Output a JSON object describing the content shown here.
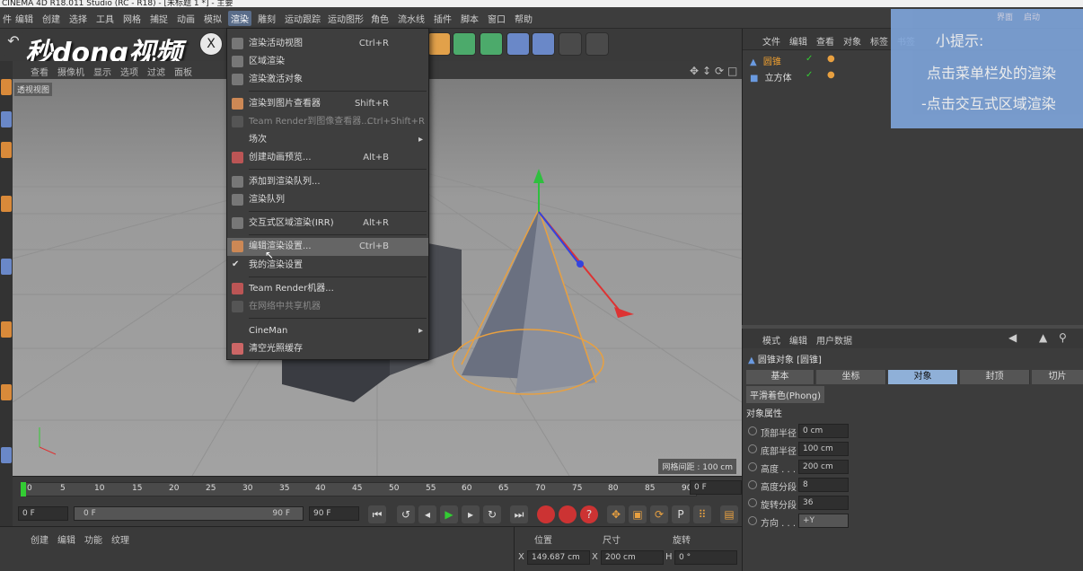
{
  "window": {
    "title": "CINEMA 4D R18.011 Studio (RC - R18) - [未标题 1 *] - 主要"
  },
  "menubar": [
    "件",
    "编辑",
    "创建",
    "选择",
    "工具",
    "网格",
    "捕捉",
    "动画",
    "模拟",
    "渲染",
    "雕刻",
    "运动跟踪",
    "运动图形",
    "角色",
    "流水线",
    "插件",
    "脚本",
    "窗口",
    "帮助"
  ],
  "logo": "秒dong视频",
  "viewport": {
    "menu": [
      "查看",
      "摄像机",
      "显示",
      "选项",
      "过滤",
      "面板"
    ],
    "label": "透视视图",
    "grid_info": "网格间距 : 100 cm"
  },
  "render_menu": [
    {
      "label": "渲染活动视图",
      "shortcut": "Ctrl+R"
    },
    {
      "label": "区域渲染",
      "shortcut": ""
    },
    {
      "label": "渲染激活对象",
      "shortcut": ""
    },
    {
      "label": "渲染到图片查看器",
      "shortcut": "Shift+R"
    },
    {
      "label": "Team Render到图像查看器...",
      "shortcut": "Ctrl+Shift+R"
    },
    {
      "label": "场次",
      "shortcut": ""
    },
    {
      "label": "创建动画预览...",
      "shortcut": "Alt+B"
    },
    {
      "label": "添加到渲染队列...",
      "shortcut": ""
    },
    {
      "label": "渲染队列",
      "shortcut": ""
    },
    {
      "label": "交互式区域渲染(IRR)",
      "shortcut": "Alt+R"
    },
    {
      "label": "编辑渲染设置...",
      "shortcut": "Ctrl+B"
    },
    {
      "label": "我的渲染设置",
      "shortcut": ""
    },
    {
      "label": "Team Render机器...",
      "shortcut": ""
    },
    {
      "label": "在网络中共享机器",
      "shortcut": ""
    },
    {
      "label": "CineMan",
      "shortcut": ""
    },
    {
      "label": "清空光照缓存",
      "shortcut": ""
    }
  ],
  "timeline": {
    "ticks": [
      "0",
      "5",
      "10",
      "15",
      "20",
      "25",
      "30",
      "35",
      "40",
      "45",
      "50",
      "55",
      "60",
      "65",
      "70",
      "75",
      "80",
      "85",
      "90"
    ],
    "current_frame": "0 F",
    "start": "0 F",
    "range_start": "0 F",
    "range_end": "90 F",
    "end": "90 F"
  },
  "bottom_tabs": [
    "创建",
    "编辑",
    "功能",
    "纹理"
  ],
  "coords": {
    "headers": [
      "位置",
      "尺寸",
      "旋转"
    ],
    "x_pos": "149.687 cm",
    "x_size": "200 cm",
    "h_rot": "0 °"
  },
  "object_manager": {
    "menu": [
      "文件",
      "编辑",
      "查看",
      "对象",
      "标签",
      "书签"
    ],
    "objects": [
      "圆锥",
      "立方体"
    ]
  },
  "hint": {
    "title": "小提示:",
    "line1": "点击菜单栏处的渲染",
    "line2": "-点击交互式区域渲染",
    "top_tabs": [
      "界面",
      "启动"
    ]
  },
  "attributes": {
    "menu": [
      "模式",
      "编辑",
      "用户数据"
    ],
    "title": "圆锥对象 [圆锥]",
    "tabs": [
      "基本",
      "坐标",
      "对象",
      "封顶",
      "切片"
    ],
    "active_tab": "对象",
    "phong": "平滑着色(Phong)",
    "section": "对象属性",
    "props": [
      {
        "label": "顶部半径",
        "value": "0 cm"
      },
      {
        "label": "底部半径",
        "value": "100 cm"
      },
      {
        "label": "高度 . . .",
        "value": "200 cm"
      },
      {
        "label": "高度分段",
        "value": "8"
      },
      {
        "label": "旋转分段",
        "value": "36"
      },
      {
        "label": "方向 . . .",
        "value": "+Y"
      }
    ]
  },
  "colors": {
    "accent": "#8fb0d8",
    "hint_bg": "#7ea5db",
    "menu_highlight": "#656565"
  }
}
